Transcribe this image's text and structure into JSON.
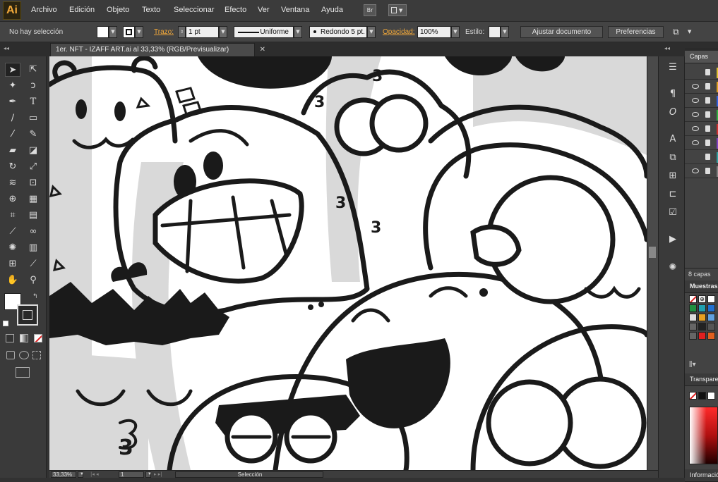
{
  "app": {
    "logo": "Ai",
    "bridge_label": "Br"
  },
  "menu": [
    "Archivo",
    "Edición",
    "Objeto",
    "Texto",
    "Seleccionar",
    "Efecto",
    "Ver",
    "Ventana",
    "Ayuda"
  ],
  "control_bar": {
    "selection_status": "No hay selección",
    "stroke_label": "Trazo:",
    "stroke_weight": "1 pt",
    "stroke_profile": "Uniforme",
    "brush": "Redondo 5 pt.",
    "opacity_label": "Opacidad:",
    "opacity_value": "100%",
    "style_label": "Estilo:",
    "doc_setup_button": "Ajustar documento",
    "preferences_button": "Preferencias"
  },
  "document": {
    "tab_title": "1er. NFT - IZAFF ART.ai al 33,33% (RGB/Previsualizar)"
  },
  "status_bar": {
    "zoom": "33,33%",
    "artboard": "1",
    "tool_status": "Selección"
  },
  "panels": {
    "layers_tab": "Capas",
    "layers_count": "8 capas",
    "swatches_tab": "Muestras",
    "transparency_tab": "Transparencia",
    "info_tab": "Información"
  },
  "colors": {
    "accent": "#f2a93b",
    "ui_dark": "#323232",
    "canvas_bg": "#ffffff",
    "artwork_gray": "#d9d9d9",
    "artwork_ink": "#1a1a1a"
  },
  "icons": [
    "selection-tool-icon",
    "direct-selection-tool-icon",
    "pen-tool-icon",
    "type-tool-icon",
    "hand-tool-icon",
    "zoom-tool-icon",
    "eye-icon",
    "lock-icon"
  ]
}
